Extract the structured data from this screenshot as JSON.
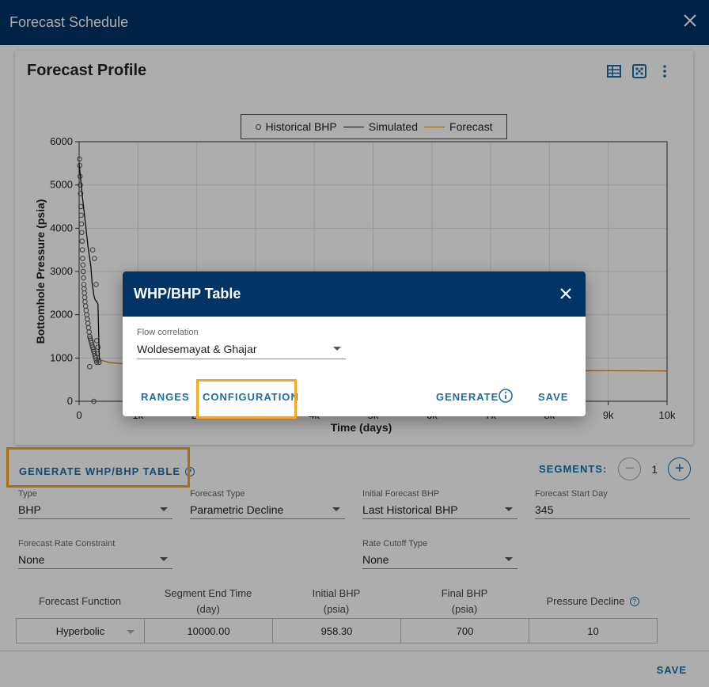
{
  "window": {
    "title": "Forecast Schedule"
  },
  "card": {
    "title": "Forecast Profile",
    "tools": [
      "table-icon",
      "scatter-icon",
      "more-vert-icon"
    ]
  },
  "chart_data": {
    "type": "scatter",
    "xlabel": "Time (days)",
    "ylabel": "Bottomhole Pressure (psia)",
    "xlim": [
      0,
      10000
    ],
    "ylim": [
      0,
      6000
    ],
    "x_ticks": [
      "0",
      "1k",
      "2k",
      "3k",
      "4k",
      "5k",
      "6k",
      "7k",
      "8k",
      "9k",
      "10k"
    ],
    "y_ticks": [
      "0",
      "1000",
      "2000",
      "3000",
      "4000",
      "5000",
      "6000"
    ],
    "grid": true,
    "legend": {
      "position": "top",
      "entries": [
        "Historical BHP",
        "Simulated",
        "Forecast"
      ]
    },
    "series": [
      {
        "name": "Historical BHP",
        "style": "circle-markers",
        "color": "#555555",
        "points": [
          [
            5,
            5600
          ],
          [
            10,
            5450
          ],
          [
            15,
            5200
          ],
          [
            20,
            5000
          ],
          [
            25,
            4800
          ],
          [
            30,
            4500
          ],
          [
            35,
            4300
          ],
          [
            40,
            4100
          ],
          [
            45,
            3900
          ],
          [
            50,
            3700
          ],
          [
            55,
            3500
          ],
          [
            60,
            3300
          ],
          [
            65,
            3150
          ],
          [
            70,
            3000
          ],
          [
            75,
            2850
          ],
          [
            80,
            2700
          ],
          [
            85,
            2600
          ],
          [
            90,
            2500
          ],
          [
            95,
            2400
          ],
          [
            100,
            2300
          ],
          [
            110,
            2200
          ],
          [
            120,
            2100
          ],
          [
            130,
            2000
          ],
          [
            140,
            1900
          ],
          [
            150,
            1800
          ],
          [
            160,
            1700
          ],
          [
            170,
            1600
          ],
          [
            180,
            1500
          ],
          [
            190,
            1450
          ],
          [
            200,
            1400
          ],
          [
            210,
            1350
          ],
          [
            220,
            1300
          ],
          [
            230,
            1250
          ],
          [
            240,
            1200
          ],
          [
            250,
            1150
          ],
          [
            260,
            1100
          ],
          [
            270,
            1050
          ],
          [
            280,
            1000
          ],
          [
            290,
            950
          ],
          [
            300,
            900
          ],
          [
            310,
            1100
          ],
          [
            320,
            1250
          ],
          [
            330,
            950
          ],
          [
            340,
            900
          ],
          [
            230,
            3500
          ],
          [
            290,
            2700
          ],
          [
            180,
            800
          ],
          [
            250,
            0
          ],
          [
            260,
            3300
          ],
          [
            300,
            1400
          ]
        ]
      },
      {
        "name": "Simulated",
        "style": "line",
        "color": "#111111",
        "points": [
          [
            0,
            5500
          ],
          [
            50,
            4800
          ],
          [
            100,
            4200
          ],
          [
            150,
            3600
          ],
          [
            200,
            3100
          ],
          [
            220,
            2750
          ],
          [
            250,
            2450
          ],
          [
            270,
            2350
          ],
          [
            300,
            2300
          ],
          [
            320,
            2250
          ],
          [
            340,
            1100
          ],
          [
            345,
            958
          ]
        ]
      },
      {
        "name": "Forecast",
        "style": "line",
        "color": "#d98c1a",
        "points": [
          [
            345,
            958
          ],
          [
            500,
            900
          ],
          [
            1000,
            830
          ],
          [
            2000,
            790
          ],
          [
            3000,
            765
          ],
          [
            5000,
            735
          ],
          [
            7000,
            715
          ],
          [
            10000,
            700
          ]
        ]
      }
    ]
  },
  "generate": {
    "label": "GENERATE WHP/BHP TABLE",
    "help": "?"
  },
  "segments": {
    "label": "SEGMENTS:",
    "count": "1",
    "minus": "−",
    "plus": "+"
  },
  "form": {
    "type": {
      "label": "Type",
      "value": "BHP"
    },
    "forecast_type": {
      "label": "Forecast Type",
      "value": "Parametric Decline"
    },
    "initial_bhp": {
      "label": "Initial Forecast BHP",
      "value": "Last Historical BHP"
    },
    "start_day": {
      "label": "Forecast Start Day",
      "value": "345"
    },
    "rate_constraint": {
      "label": "Forecast Rate Constraint",
      "value": "None"
    },
    "rate_cutoff": {
      "label": "Rate Cutoff Type",
      "value": "None"
    }
  },
  "table": {
    "headers": [
      "Forecast Function",
      "Segment End Time\n(day)",
      "Initial BHP\n(psia)",
      "Final BHP\n(psia)",
      "Pressure Decline"
    ],
    "row": [
      "Hyperbolic",
      "10000.00",
      "958.30",
      "700",
      "10"
    ]
  },
  "footer": {
    "save": "SAVE"
  },
  "modal": {
    "title": "WHP/BHP Table",
    "flow_label": "Flow correlation",
    "flow_value": "Woldesemayat & Ghajar",
    "ranges": "RANGES",
    "configuration": "CONFIGURATION",
    "generate": "GENERATE",
    "save": "SAVE"
  },
  "colors": {
    "header": "#003366",
    "accent": "#1a6fa8",
    "highlight": "#f5a623",
    "forecast": "#d98c1a"
  }
}
